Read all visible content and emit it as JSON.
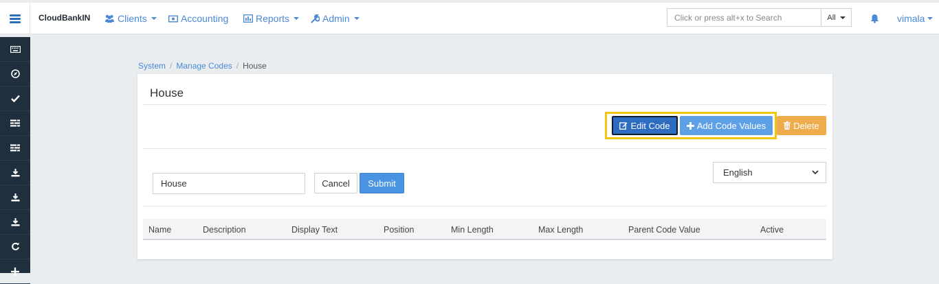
{
  "app": {
    "brand": "CloudBankIN"
  },
  "nav": {
    "clients": "Clients",
    "accounting": "Accounting",
    "reports": "Reports",
    "admin": "Admin"
  },
  "search": {
    "placeholder": "Click or press alt+x to Search",
    "scope": "All"
  },
  "user": {
    "name": "vimala"
  },
  "sidebar": {
    "icons": [
      "keyboard-icon",
      "compass-icon",
      "check-icon",
      "list-icon",
      "list-icon",
      "download-icon",
      "download-icon",
      "download-icon",
      "refresh-icon",
      "plus-icon"
    ]
  },
  "breadcrumb": {
    "items": [
      "System",
      "Manage Codes",
      "House"
    ]
  },
  "card": {
    "title": "House",
    "edit_label": "Edit Code",
    "add_label": "Add Code Values",
    "delete_label": "Delete",
    "name_value": "House",
    "cancel_label": "Cancel",
    "submit_label": "Submit",
    "language": "English"
  },
  "table": {
    "columns": [
      "Name",
      "Description",
      "Display Text",
      "Position",
      "Min Length",
      "Max Length",
      "Parent Code Value",
      "Active"
    ]
  },
  "colors": {
    "accent": "#4a89d6",
    "highlight": "#f1c40f",
    "sidebar_bg": "#1f2f3d",
    "delete": "#efac4c"
  }
}
